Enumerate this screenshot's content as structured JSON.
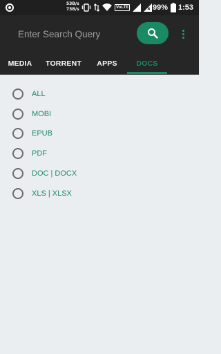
{
  "status_bar": {
    "net_speed_up": "53B/s",
    "net_speed_down": "73B/s",
    "volte": "VoLTE",
    "battery": "99%",
    "time": "1:53"
  },
  "search": {
    "placeholder": "Enter Search Query"
  },
  "icons": {
    "search": "search-icon",
    "menu": "more-vert-icon"
  },
  "tabs": [
    {
      "label": "MEDIA",
      "active": false
    },
    {
      "label": "TORRENT",
      "active": false
    },
    {
      "label": "APPS",
      "active": false
    },
    {
      "label": "DOCS",
      "active": true
    }
  ],
  "options": [
    {
      "label": "ALL",
      "selected": false
    },
    {
      "label": "MOBI",
      "selected": false
    },
    {
      "label": "EPUB",
      "selected": false
    },
    {
      "label": "PDF",
      "selected": false
    },
    {
      "label": "DOC | DOCX",
      "selected": false
    },
    {
      "label": "XLS | XLSX",
      "selected": false
    }
  ],
  "colors": {
    "accent": "#1a8a64",
    "bar_background": "#262626",
    "page_background": "#ebeef0"
  }
}
